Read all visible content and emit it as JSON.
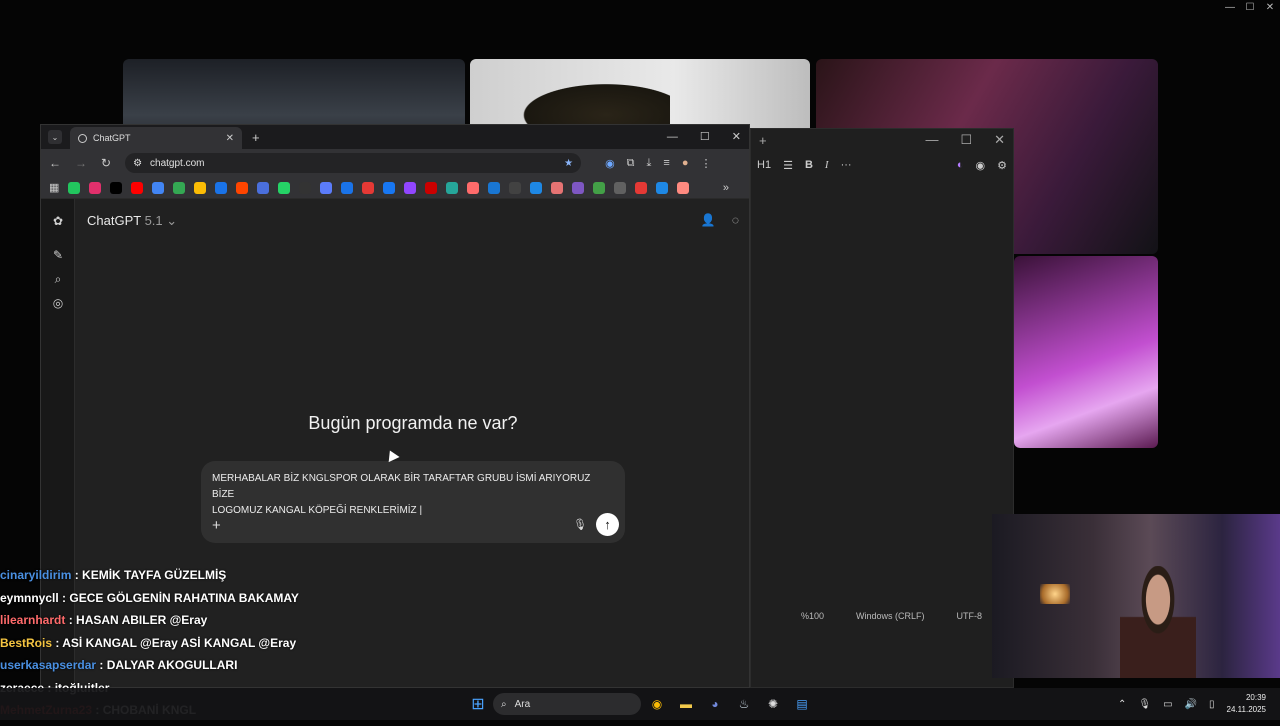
{
  "outer_window": {
    "controls": [
      "—",
      "☐",
      "✕"
    ]
  },
  "notepad": {
    "toolbar": {
      "heading": "H1",
      "bold": "B",
      "italic": "I",
      "more": "···"
    },
    "status": {
      "zoom": "%100",
      "line_ending": "Windows (CRLF)",
      "encoding": "UTF-8"
    }
  },
  "browser": {
    "tab_title": "ChatGPT",
    "url": "chatgpt.com",
    "bookmark_colors": [
      "#22c55e",
      "#e1306c",
      "#000000",
      "#ff0000",
      "#4285f4",
      "#34a853",
      "#fbbc05",
      "#1a73e8",
      "#ff4500",
      "#4a6fdc",
      "#25d366",
      "#333333",
      "#5b7cfa",
      "#1a73e8",
      "#e53935",
      "#1877f2",
      "#9146ff",
      "#cc0000",
      "#26a69a",
      "#ff6b6b",
      "#1976d2",
      "#424242",
      "#1e88e5",
      "#e57373",
      "#7e57c2",
      "#43a047",
      "#616161",
      "#e53935",
      "#1e88e5",
      "#ff8a80"
    ]
  },
  "chatgpt": {
    "model_name": "ChatGPT",
    "model_version": "5.1",
    "headline": "Bugün programda ne var?",
    "composer_text": "MERHABALAR BİZ KNGLSPOR OLARAK BİR TARAFTAR GRUBU İSMİ ARIYORUZ BİZE\nLOGOMUZ KANGAL KÖPEĞİ RENKLERİMİZ |"
  },
  "chat_messages": [
    {
      "user": "cinaryildirim",
      "color": "#4a90e2",
      "text": "KEMİK TAYFA GÜZELMİŞ"
    },
    {
      "user": "eymnnycll",
      "color": "#ffffff",
      "text": "GECE GÖLGENİN RAHATINA BAKAMAY"
    },
    {
      "user": "lilearnhardt",
      "color": "#ff6b6b",
      "text": "HASAN ABILER @Eray"
    },
    {
      "user": "BestRois",
      "color": "#f5c542",
      "text": "ASİ KANGAL @Eray ASİ KANGAL @Eray"
    },
    {
      "user": "userkasapserdar",
      "color": "#4a90e2",
      "text": "DALYAR AKOGULLARI"
    },
    {
      "user": "zeraece",
      "color": "#ffffff",
      "text": "itoğluitler"
    },
    {
      "user": "MehmetZurna23",
      "color": "#e53935",
      "text": "CHOBANİ KNGL"
    }
  ],
  "taskbar": {
    "search_placeholder": "Ara",
    "time": "20:39",
    "date": "24.11.2025"
  }
}
